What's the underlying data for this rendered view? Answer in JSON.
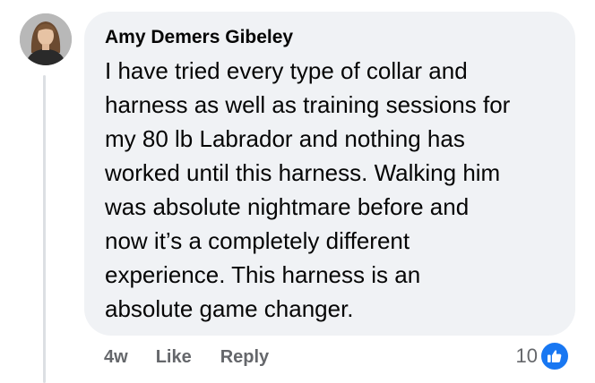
{
  "comment": {
    "author": "Amy Demers Gibeley",
    "body_lines": [
      "I have tried every type of collar and",
      "harness as well as training sessions for",
      "my 80 lb Labrador and nothing has",
      "worked until this harness. Walking him",
      "was absolute nightmare before and",
      "now it’s a completely different",
      "experience. This harness is an",
      "absolute game changer."
    ],
    "bubble_color": "#f0f2f5"
  },
  "actions": {
    "timestamp": "4w",
    "like_label": "Like",
    "reply_label": "Reply"
  },
  "reactions": {
    "count": "10",
    "icon": "thumbs-up-icon",
    "color": "#1877f2"
  }
}
